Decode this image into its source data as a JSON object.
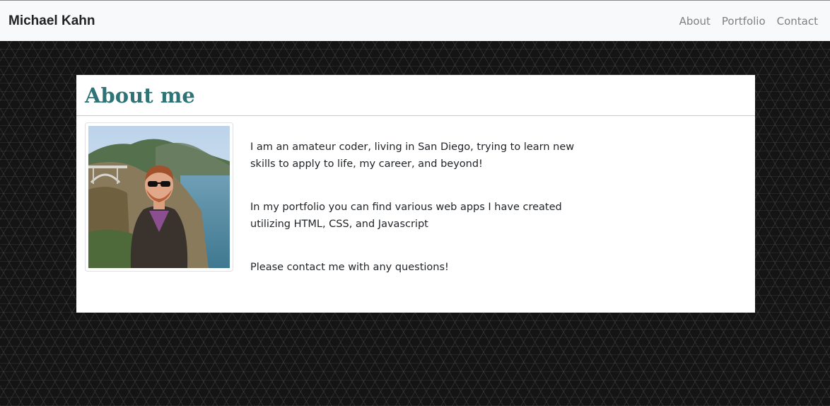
{
  "navbar": {
    "brand": "Michael Kahn",
    "links": [
      {
        "label": "About"
      },
      {
        "label": "Portfolio"
      },
      {
        "label": "Contact"
      }
    ]
  },
  "about": {
    "title": "About me",
    "paragraphs": [
      "I am an amateur coder, living in San Diego, trying to learn new skills to apply to life, my career, and beyond!",
      "In my portfolio you can find various web apps I have created utilizing HTML, CSS, and Javascript",
      "Please contact me with any questions!"
    ]
  },
  "colors": {
    "title": "#2e7477",
    "navbar_bg": "#f8f9fa",
    "page_bg": "#141414"
  }
}
